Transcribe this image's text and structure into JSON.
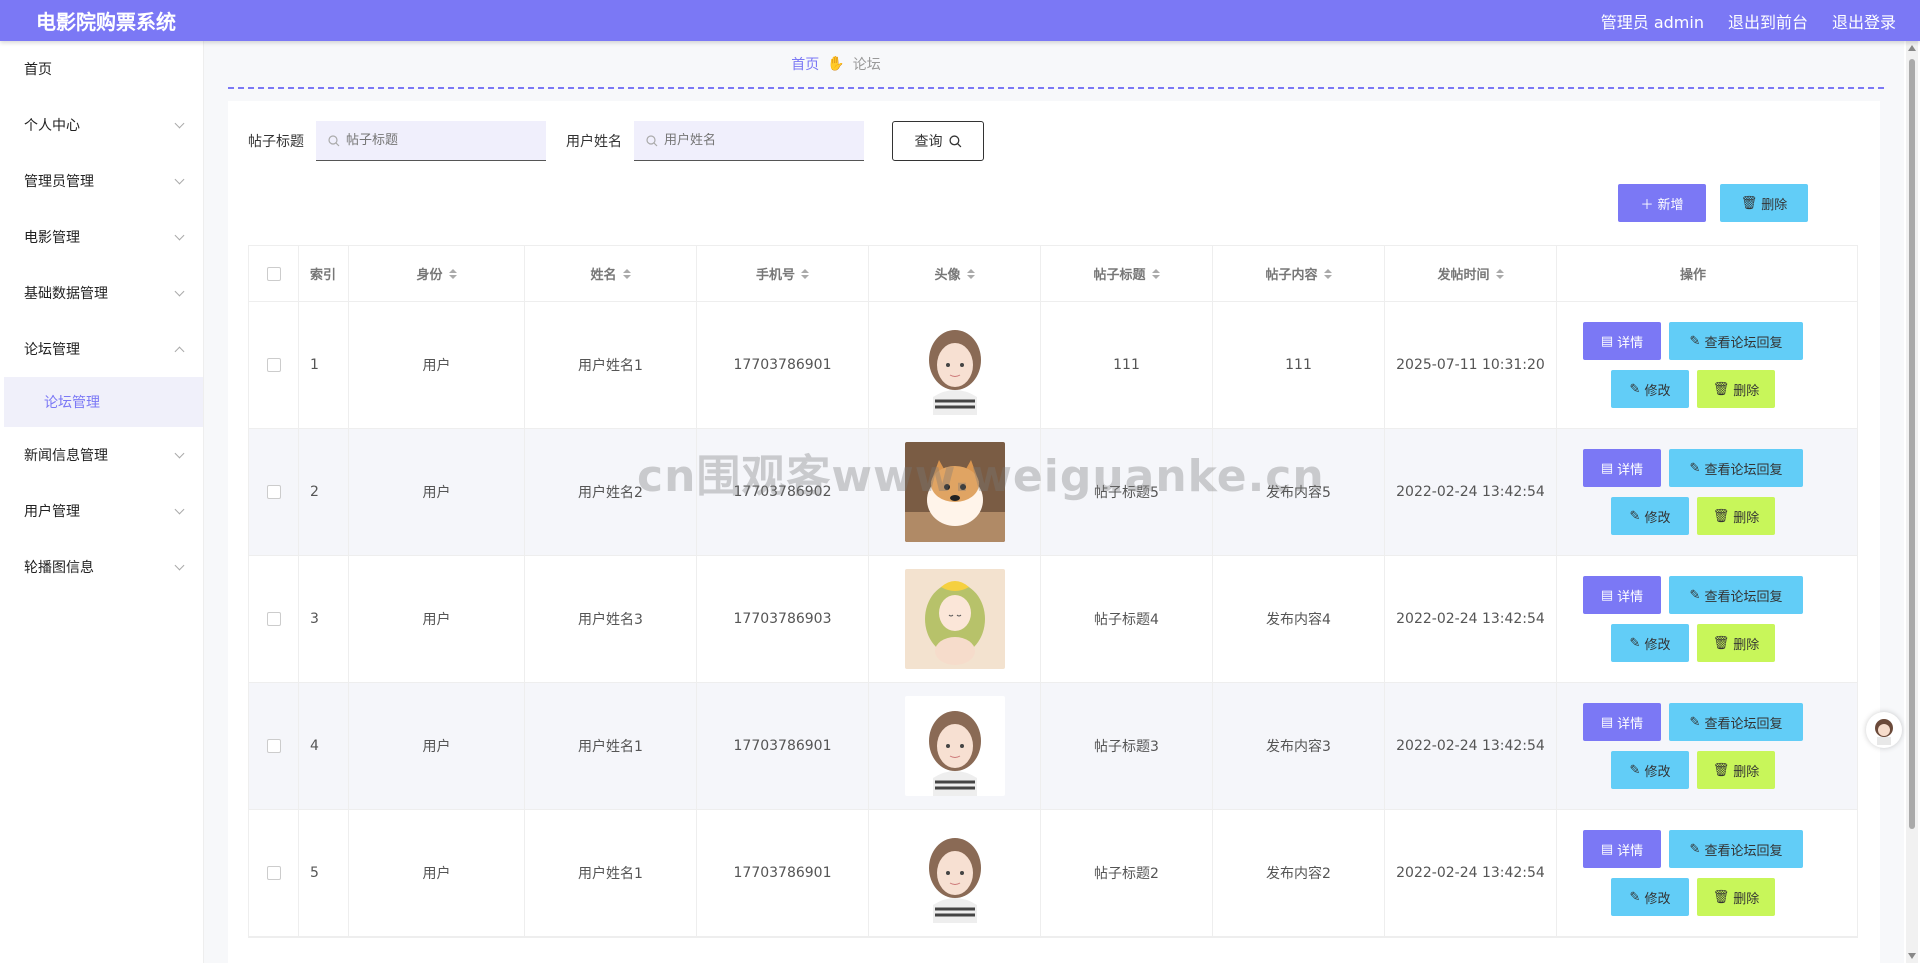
{
  "app": {
    "title": "电影院购票系统"
  },
  "header": {
    "admin_label": "管理员 admin",
    "back_label": "退出到前台",
    "logout_label": "退出登录"
  },
  "sidebar": {
    "items": [
      {
        "label": "首页"
      },
      {
        "label": "个人中心"
      },
      {
        "label": "管理员管理"
      },
      {
        "label": "电影管理"
      },
      {
        "label": "基础数据管理"
      },
      {
        "label": "论坛管理"
      },
      {
        "label": "新闻信息管理"
      },
      {
        "label": "用户管理"
      },
      {
        "label": "轮播图信息"
      }
    ],
    "active_sub": "论坛管理"
  },
  "breadcrumb": {
    "home": "首页",
    "current": "论坛"
  },
  "search": {
    "title_label": "帖子标题",
    "title_placeholder": "帖子标题",
    "name_label": "用户姓名",
    "name_placeholder": "用户姓名",
    "query_label": "查询"
  },
  "toolbar": {
    "add_label": "新增",
    "delete_label": "删除"
  },
  "table": {
    "columns": [
      "索引",
      "身份",
      "姓名",
      "手机号",
      "头像",
      "帖子标题",
      "帖子内容",
      "发帖时间",
      "操作"
    ],
    "rows": [
      {
        "index": "1",
        "role": "用户",
        "name": "用户姓名1",
        "phone": "17703786901",
        "avatar": "girl-avatar",
        "title": "111",
        "content": "111",
        "time": "2025-07-11 10:31:20"
      },
      {
        "index": "2",
        "role": "用户",
        "name": "用户姓名2",
        "phone": "17703786902",
        "avatar": "shiba-dog-avatar",
        "title": "帖子标题5",
        "content": "发布内容5",
        "time": "2022-02-24 13:42:54"
      },
      {
        "index": "3",
        "role": "用户",
        "name": "用户姓名3",
        "phone": "17703786903",
        "avatar": "anime-girl-avatar",
        "title": "帖子标题4",
        "content": "发布内容4",
        "time": "2022-02-24 13:42:54"
      },
      {
        "index": "4",
        "role": "用户",
        "name": "用户姓名1",
        "phone": "17703786901",
        "avatar": "girl-avatar",
        "title": "帖子标题3",
        "content": "发布内容3",
        "time": "2022-02-24 13:42:54"
      },
      {
        "index": "5",
        "role": "用户",
        "name": "用户姓名1",
        "phone": "17703786901",
        "avatar": "girl-avatar",
        "title": "帖子标题2",
        "content": "发布内容2",
        "time": "2022-02-24 13:42:54"
      }
    ],
    "ops": {
      "detail": "详情",
      "reply": "查看论坛回复",
      "edit": "修改",
      "remove": "删除"
    }
  },
  "watermark": "cn围观客www.weiguanke.cn",
  "colors": {
    "accent": "#7b78f5",
    "cyan": "#62cdf7",
    "lime": "#c8f65a"
  }
}
